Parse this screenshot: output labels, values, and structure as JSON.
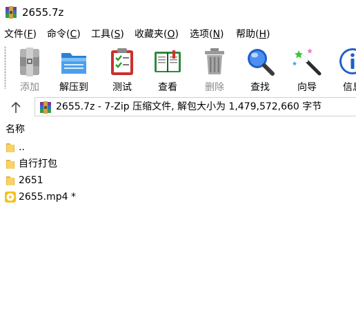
{
  "window": {
    "title": "2655.7z",
    "accent_color": "#1a73e8"
  },
  "menu": [
    {
      "label": "文件(",
      "key": "F",
      "suffix": ")"
    },
    {
      "label": "命令(",
      "key": "C",
      "suffix": ")"
    },
    {
      "label": "工具(",
      "key": "S",
      "suffix": ")"
    },
    {
      "label": "收藏夹(",
      "key": "O",
      "suffix": ")"
    },
    {
      "label": "选项(",
      "key": "N",
      "suffix": ")"
    },
    {
      "label": "帮助(",
      "key": "H",
      "suffix": ")"
    }
  ],
  "toolbar": {
    "add": {
      "label": "添加",
      "icon": "archive-add-icon",
      "enabled": false
    },
    "extract": {
      "label": "解压到",
      "icon": "folder-extract-icon",
      "enabled": true
    },
    "test": {
      "label": "测试",
      "icon": "test-clipboard-icon",
      "enabled": true
    },
    "view": {
      "label": "查看",
      "icon": "book-view-icon",
      "enabled": true
    },
    "delete": {
      "label": "删除",
      "icon": "trash-icon",
      "enabled": false
    },
    "find": {
      "label": "查找",
      "icon": "magnifier-icon",
      "enabled": true
    },
    "wizard": {
      "label": "向导",
      "icon": "magic-wand-icon",
      "enabled": true
    },
    "info": {
      "label": "信息",
      "icon": "info-icon",
      "enabled": true
    }
  },
  "address": {
    "path": "2655.7z - 7-Zip 压缩文件, 解包大小为 1,479,572,660 字节"
  },
  "list": {
    "column_name": "名称",
    "items": [
      {
        "name": "..",
        "icon": "folder-icon"
      },
      {
        "name": "自行打包",
        "icon": "folder-icon"
      },
      {
        "name": "2651",
        "icon": "folder-icon"
      },
      {
        "name": "2655.mp4 *",
        "icon": "video-file-icon"
      }
    ]
  }
}
